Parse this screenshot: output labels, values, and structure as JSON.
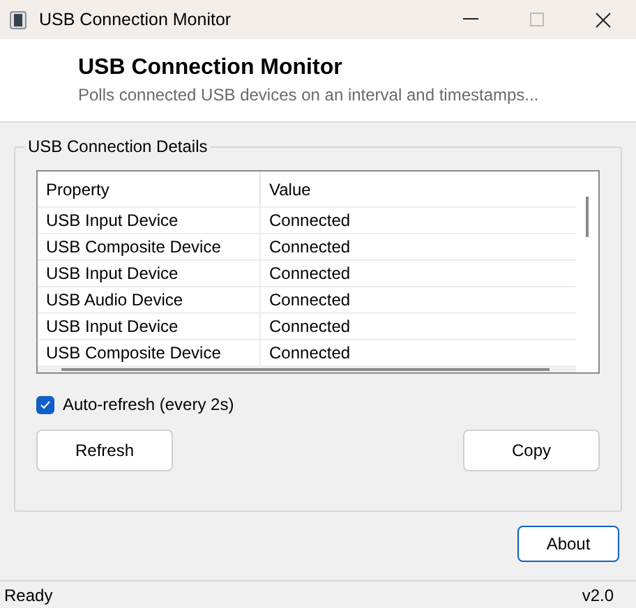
{
  "window": {
    "title": "USB Connection Monitor"
  },
  "header": {
    "title": "USB Connection Monitor",
    "subtitle": "Polls connected USB devices on an interval and timestamps..."
  },
  "group": {
    "title": "USB Connection Details"
  },
  "table": {
    "columns": [
      "Property",
      "Value"
    ],
    "rows": [
      {
        "cells": [
          "USB Input Device",
          "Connected"
        ]
      },
      {
        "cells": [
          "USB Composite Device",
          "Connected"
        ]
      },
      {
        "cells": [
          "USB Input Device",
          "Connected"
        ]
      },
      {
        "cells": [
          "USB Audio Device",
          "Connected"
        ]
      },
      {
        "cells": [
          "USB Input Device",
          "Connected"
        ]
      },
      {
        "cells": [
          "USB Composite Device",
          "Connected"
        ]
      }
    ]
  },
  "auto_refresh": {
    "label": "Auto-refresh (every 2s)",
    "checked": true
  },
  "buttons": [
    {
      "label": "Refresh"
    },
    {
      "label": "Copy"
    }
  ],
  "about_button": {
    "label": "About"
  },
  "status_bar": {
    "text": "Ready",
    "version": "v2.0"
  }
}
